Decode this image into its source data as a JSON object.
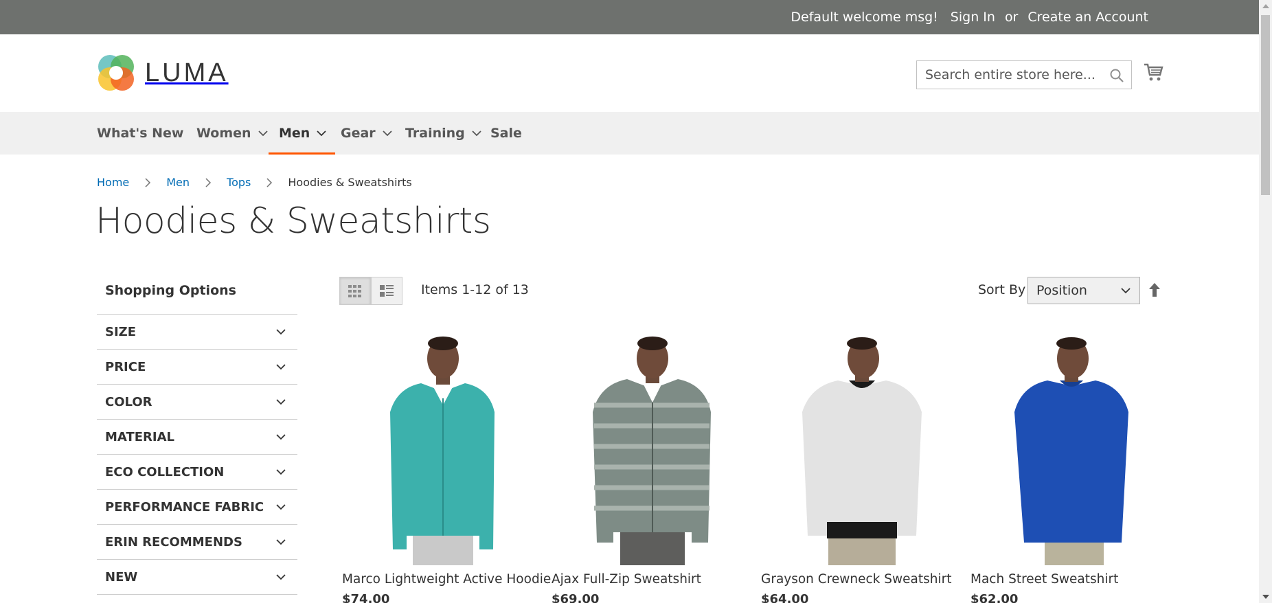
{
  "panel": {
    "welcome": "Default welcome msg!",
    "sign_in": "Sign In",
    "or": "or",
    "create_account": "Create an Account"
  },
  "header": {
    "logo_text": "LUMA",
    "search_placeholder": "Search entire store here...",
    "search_value": ""
  },
  "nav": {
    "items": [
      {
        "label": "What's New",
        "has_submenu": false
      },
      {
        "label": "Women",
        "has_submenu": true
      },
      {
        "label": "Men",
        "has_submenu": true,
        "active": true
      },
      {
        "label": "Gear",
        "has_submenu": true
      },
      {
        "label": "Training",
        "has_submenu": true
      },
      {
        "label": "Sale",
        "has_submenu": false
      }
    ],
    "active_color": "#ff5501"
  },
  "breadcrumbs": {
    "items": [
      "Home",
      "Men",
      "Tops"
    ],
    "current": "Hoodies & Sweatshirts"
  },
  "page_title": "Hoodies & Sweatshirts",
  "sidebar": {
    "title": "Shopping Options",
    "filters": [
      "SIZE",
      "PRICE",
      "COLOR",
      "MATERIAL",
      "ECO COLLECTION",
      "PERFORMANCE FABRIC",
      "ERIN RECOMMENDS",
      "NEW"
    ]
  },
  "toolbar": {
    "view_modes": [
      {
        "mode": "grid",
        "icon": "grid-icon",
        "active": true
      },
      {
        "mode": "list",
        "icon": "list-icon",
        "active": false
      }
    ],
    "amount": "Items 1-12 of 13",
    "sort_label": "Sort By",
    "sort_value": "Position",
    "sort_direction_icon": "arrow-up-icon"
  },
  "products": [
    {
      "name": "Marco Lightweight Active Hoodie",
      "price": "$74.00",
      "top_color": "#3cb1ac",
      "bottom_color": "#c9c9c9"
    },
    {
      "name": "Ajax Full-Zip Sweatshirt",
      "price": "$69.00",
      "top_color": "#7e8c86",
      "bottom_color": "#5e5e5c"
    },
    {
      "name": "Grayson Crewneck Sweatshirt",
      "price": "$64.00",
      "top_color": "#e3e3e3",
      "bottom_color": "#b6ad99"
    },
    {
      "name": "Mach Street Sweatshirt",
      "price": "$62.00",
      "top_color": "#1e4fb4",
      "bottom_color": "#b9b39c"
    }
  ]
}
